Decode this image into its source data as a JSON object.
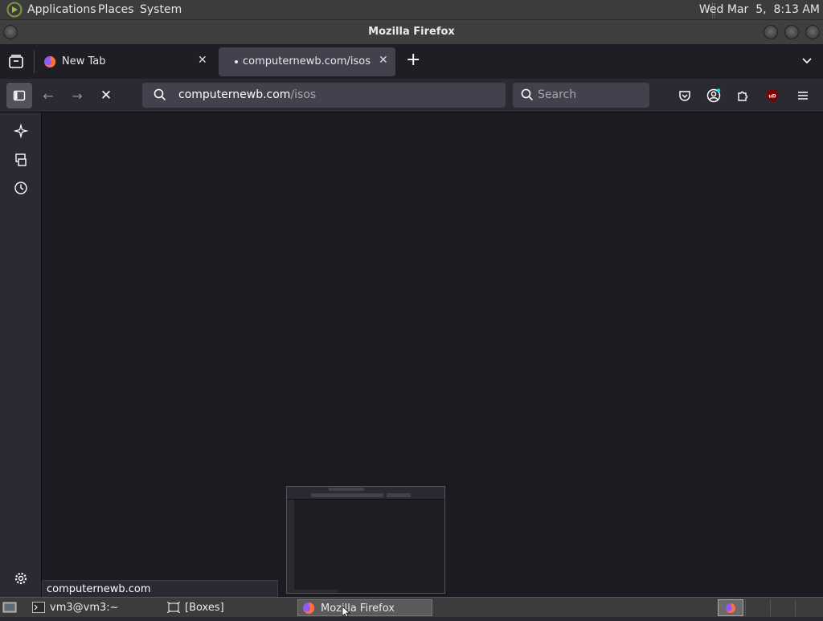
{
  "top_panel": {
    "menus": [
      "Applications",
      "Places",
      "System"
    ],
    "clock": "Wed Mar  5,  8:13 AM"
  },
  "window": {
    "title": "Mozilla Firefox"
  },
  "tabs": [
    {
      "label": "New Tab",
      "active": false
    },
    {
      "label": "computernewb.com/isos",
      "active": true
    }
  ],
  "navbar": {
    "url_domain": "computernewb.com",
    "url_path": "/isos",
    "search_placeholder": "Search",
    "ublock_badge": "uD"
  },
  "status_text": "computernewb.com",
  "taskbar": {
    "items": [
      "vm3@vm3:~",
      "[Boxes]",
      "Mozilla Firefox"
    ]
  },
  "colors": {
    "accent": "#00ddff",
    "ublock": "#800000",
    "firefox_orange": "#ff7139",
    "firefox_purple": "#9059ff"
  }
}
